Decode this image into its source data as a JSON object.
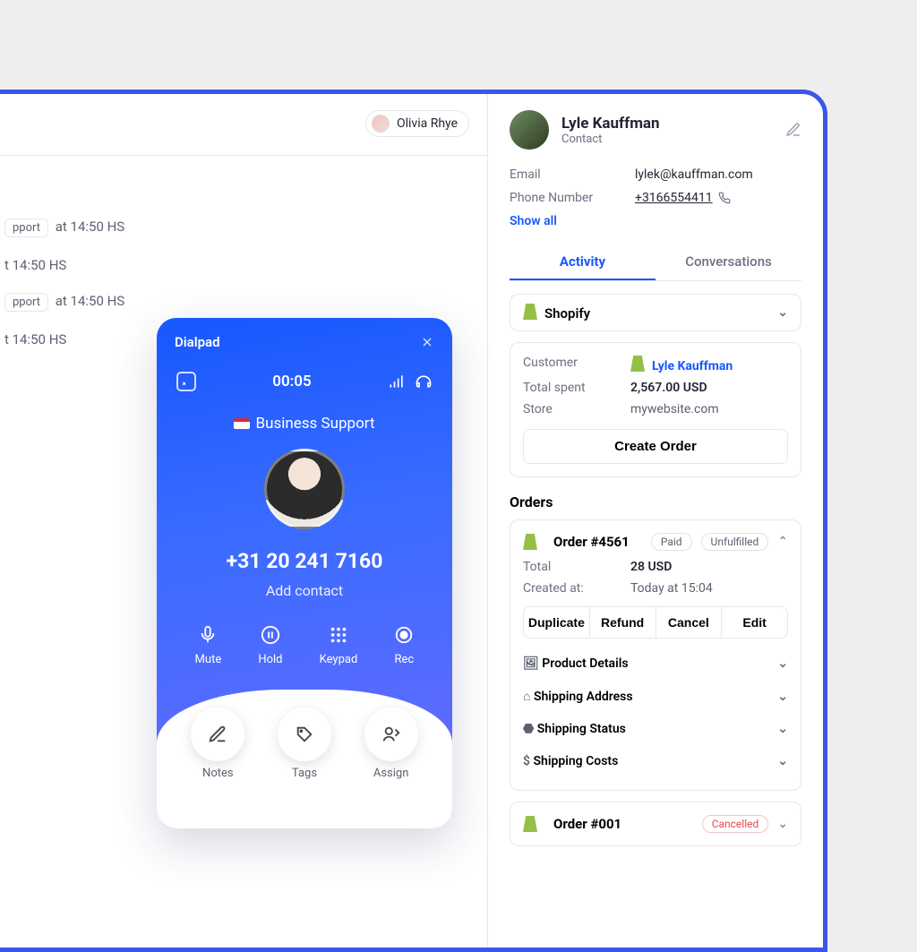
{
  "colors": {
    "accent": "#1757ff",
    "danger": "#e5484d"
  },
  "left": {
    "user": "Olivia Rhye",
    "feed": [
      {
        "tag": "pport",
        "time": "at 14:50 HS"
      },
      {
        "text": "t 14:50 HS"
      },
      {
        "tag": "pport",
        "time": "at 14:50 HS"
      },
      {
        "text": "t 14:50 HS"
      }
    ]
  },
  "dialpad": {
    "title": "Dialpad",
    "timer": "00:05",
    "label": "Business Support",
    "phone": "+31 20 241 7160",
    "add_contact": "Add contact",
    "actions": {
      "mute": "Mute",
      "hold": "Hold",
      "keypad": "Keypad",
      "rec": "Rec"
    },
    "bottom": {
      "notes": "Notes",
      "tags": "Tags",
      "assign": "Assign"
    }
  },
  "contact": {
    "name": "Lyle Kauffman",
    "type": "Contact",
    "email_label": "Email",
    "email": "lylek@kauffman.com",
    "phone_label": "Phone Number",
    "phone": "+3166554411",
    "show_all": "Show all",
    "tabs": {
      "activity": "Activity",
      "conversations": "Conversations"
    },
    "shopify_label": "Shopify",
    "customer_label": "Customer",
    "customer": "Lyle Kauffman",
    "spent_label": "Total spent",
    "spent": "2,567.00 USD",
    "store_label": "Store",
    "store": "mywebsite.com",
    "create_order": "Create Order",
    "orders_heading": "Orders"
  },
  "order1": {
    "title": "Order #4561",
    "status1": "Paid",
    "status2": "Unfulfilled",
    "total_label": "Total",
    "total": "28 USD",
    "created_label": "Created at:",
    "created": "Today at 15:04",
    "btn_duplicate": "Duplicate",
    "btn_refund": "Refund",
    "btn_cancel": "Cancel",
    "btn_edit": "Edit",
    "acc_product": "Product Details",
    "acc_ship_addr": "Shipping Address",
    "acc_ship_status": "Shipping Status",
    "acc_ship_cost": "Shipping Costs"
  },
  "order2": {
    "title": "Order #001",
    "status": "Cancelled"
  }
}
